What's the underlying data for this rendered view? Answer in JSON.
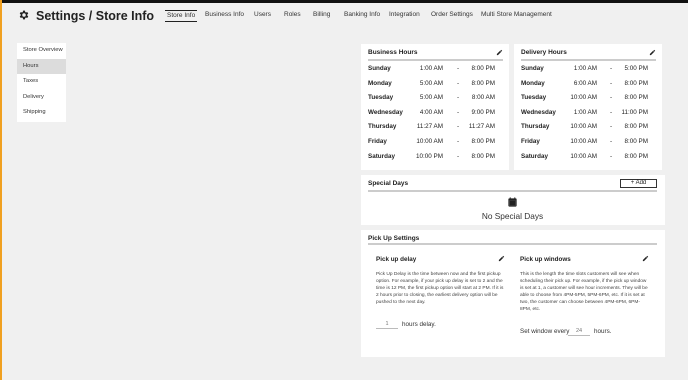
{
  "header": {
    "title": "Settings / Store Info",
    "icon": "gear-icon",
    "tabs": [
      {
        "label": "Store Info",
        "active": true
      },
      {
        "label": "Business Info"
      },
      {
        "label": "Users"
      },
      {
        "label": "Roles"
      },
      {
        "label": "Billing"
      },
      {
        "label": "Banking Info"
      },
      {
        "label": "Integration"
      },
      {
        "label": "Order Settings"
      },
      {
        "label": "Multi Store Management"
      }
    ]
  },
  "sidebar": {
    "items": [
      {
        "label": "Store Overview"
      },
      {
        "label": "Hours",
        "active": true
      },
      {
        "label": "Taxes"
      },
      {
        "label": "Delivery"
      },
      {
        "label": "Shipping"
      }
    ]
  },
  "business_hours": {
    "title": "Business Hours",
    "rows": [
      {
        "day": "Sunday",
        "open": "1:00 AM",
        "sep": "-",
        "close": "8:00 PM"
      },
      {
        "day": "Monday",
        "open": "5:00 AM",
        "sep": "-",
        "close": "8:00 PM"
      },
      {
        "day": "Tuesday",
        "open": "5:00 AM",
        "sep": "-",
        "close": "8:00 AM"
      },
      {
        "day": "Wednesday",
        "open": "4:00 AM",
        "sep": "-",
        "close": "9:00 PM"
      },
      {
        "day": "Thursday",
        "open": "11:27 AM",
        "sep": "-",
        "close": "11:27 AM"
      },
      {
        "day": "Friday",
        "open": "10:00 AM",
        "sep": "-",
        "close": "8:00 PM"
      },
      {
        "day": "Saturday",
        "open": "10:00 PM",
        "sep": "-",
        "close": "8:00 PM"
      }
    ]
  },
  "delivery_hours": {
    "title": "Delivery Hours",
    "rows": [
      {
        "day": "Sunday",
        "open": "1:00 AM",
        "sep": "-",
        "close": "5:00 PM"
      },
      {
        "day": "Monday",
        "open": "6:00 AM",
        "sep": "-",
        "close": "8:00 PM"
      },
      {
        "day": "Tuesday",
        "open": "10:00 AM",
        "sep": "-",
        "close": "8:00 PM"
      },
      {
        "day": "Wednesday",
        "open": "1:00 AM",
        "sep": "-",
        "close": "11:00 PM"
      },
      {
        "day": "Thursday",
        "open": "10:00 AM",
        "sep": "-",
        "close": "8:00 PM"
      },
      {
        "day": "Friday",
        "open": "10:00 AM",
        "sep": "-",
        "close": "8:00 PM"
      },
      {
        "day": "Saturday",
        "open": "10:00 AM",
        "sep": "-",
        "close": "8:00 PM"
      }
    ]
  },
  "special_days": {
    "title": "Special Days",
    "add_label": "+ Add",
    "empty_text": "No Special Days",
    "icon": "calendar-icon"
  },
  "pickup": {
    "title": "Pick Up Settings",
    "delay": {
      "title": "Pick up delay",
      "description": "Pick Up Delay is the time between now and the first pickup option. For example, if your pick up delay is set to 2 and the time is 12 PM, the first pickup option will start at 2 PM. If it is 2 hours prior to closing, the earliest delivery option will be pushed to the next day.",
      "placeholder": "1",
      "unit_label": "hours delay."
    },
    "windows": {
      "title": "Pick up windows",
      "description": "This is the length the time slots customers will see when scheduling their pick up. For example, if the pick up window is set at 1, a customer will see hour increments. They will be able to choose from 4PM-5PM, 5PM-6PM, etc. If it is set at two, the customer can choose between 4PM-6PM, 6PM-8PM, etc.",
      "prefix_label": "Set window every",
      "placeholder": "24",
      "unit_label": "hours."
    }
  },
  "colors": {
    "accent_left": "#f0a020",
    "background": "#f0f0f0",
    "card": "#ffffff"
  }
}
